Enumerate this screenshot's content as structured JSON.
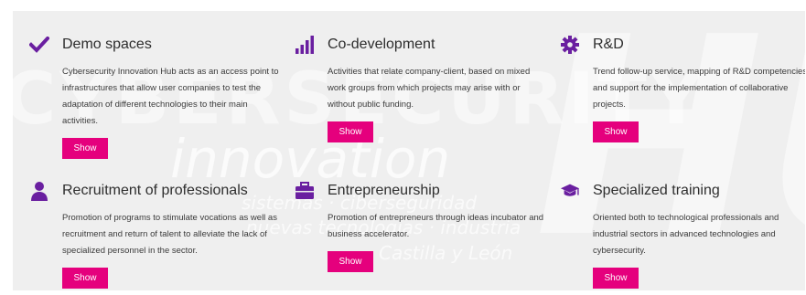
{
  "cards": [
    {
      "icon": "check-icon",
      "title": "Demo spaces",
      "description": "Cybersecurity Innovation Hub acts as an access point to infrastructures that allow user companies to test the adaptation of different technologies to their main activities.",
      "button": "Show"
    },
    {
      "icon": "bar-chart-icon",
      "title": "Co-development",
      "description": "Activities that relate company-client, based on mixed work groups from which projects may arise with or without public funding.",
      "button": "Show"
    },
    {
      "icon": "gear-icon",
      "title": "R&D",
      "description": "Trend follow-up service, mapping of R&D competencies and support for the implementation of collaborative projects.",
      "button": "Show"
    },
    {
      "icon": "user-icon",
      "title": "Recruitment of professionals",
      "description": "Promotion of programs to stimulate vocations as well as recruitment and return of talent to alleviate the lack of specialized personnel in the sector.",
      "button": "Show"
    },
    {
      "icon": "briefcase-icon",
      "title": "Entrepreneurship",
      "description": "Promotion of entrepreneurs through ideas incubator and business accelerator.",
      "button": "Show"
    },
    {
      "icon": "graduation-cap-icon",
      "title": "Specialized training",
      "description": "Oriented both to technological professionals and industrial sectors in advanced technologies and cybersecurity.",
      "button": "Show"
    }
  ],
  "colors": {
    "icon": "#6a1fa0",
    "button": "#e5007d",
    "background": "#efefef"
  }
}
